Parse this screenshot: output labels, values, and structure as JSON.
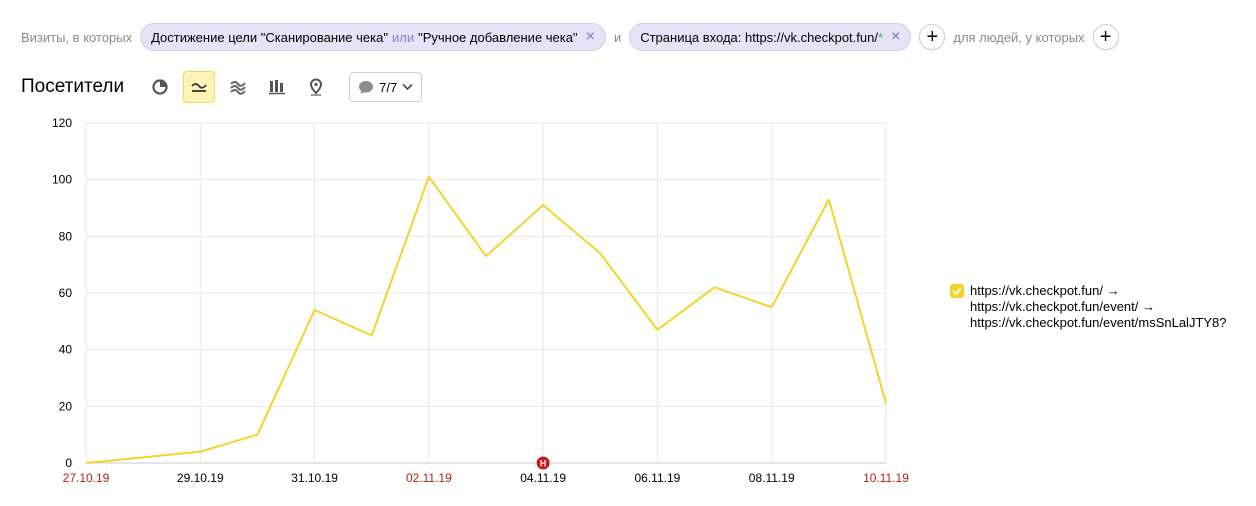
{
  "filters": {
    "visits_label": "Визиты, в которых",
    "chip1": {
      "part1": "Достижение цели \"Сканирование чека\"",
      "or": "или",
      "part2": "\"Ручное добавление чека\""
    },
    "and_label": "и",
    "chip2": {
      "text": "Страница входа: https://vk.checkpot.fun/",
      "star": "*"
    },
    "people_label": "для людей, у которых"
  },
  "toolbar": {
    "title": "Посетители",
    "notes_count": "7/7"
  },
  "chart_data": {
    "type": "line",
    "x": [
      "27.10.19",
      "28.10.19",
      "29.10.19",
      "30.10.19",
      "31.10.19",
      "01.11.19",
      "02.11.19",
      "03.11.19",
      "04.11.19",
      "05.11.19",
      "06.11.19",
      "07.11.19",
      "08.11.19",
      "09.11.19",
      "10.11.19"
    ],
    "x_tick_labels": [
      "27.10.19",
      "29.10.19",
      "31.10.19",
      "02.11.19",
      "04.11.19",
      "06.11.19",
      "08.11.19",
      "10.11.19"
    ],
    "weekend_ticks": [
      "27.10.19",
      "02.11.19",
      "10.11.19"
    ],
    "series": [
      {
        "name": "https://vk.checkpot.fun/ → https://vk.checkpot.fun/event/ → https://vk.checkpot.fun/event/msSnLalJTY8?",
        "color": "#f2d42a",
        "values": [
          0,
          2,
          4,
          10,
          54,
          45,
          101,
          73,
          91,
          74,
          47,
          62,
          55,
          93,
          21
        ]
      }
    ],
    "ylim": [
      0,
      120
    ],
    "yticks": [
      0,
      20,
      40,
      60,
      80,
      100,
      120
    ],
    "grid": true,
    "legend_position": "right",
    "annotation": {
      "x": "04.11.19",
      "label": "Н",
      "color": "#c8161d"
    },
    "weekend_color": "#b5211b"
  },
  "legend": {
    "lines": [
      "https://vk.checkpot.fun/ →",
      "https://vk.checkpot.fun/event/ →",
      "https://vk.checkpot.fun/event/msSnLalJTY8?"
    ]
  }
}
